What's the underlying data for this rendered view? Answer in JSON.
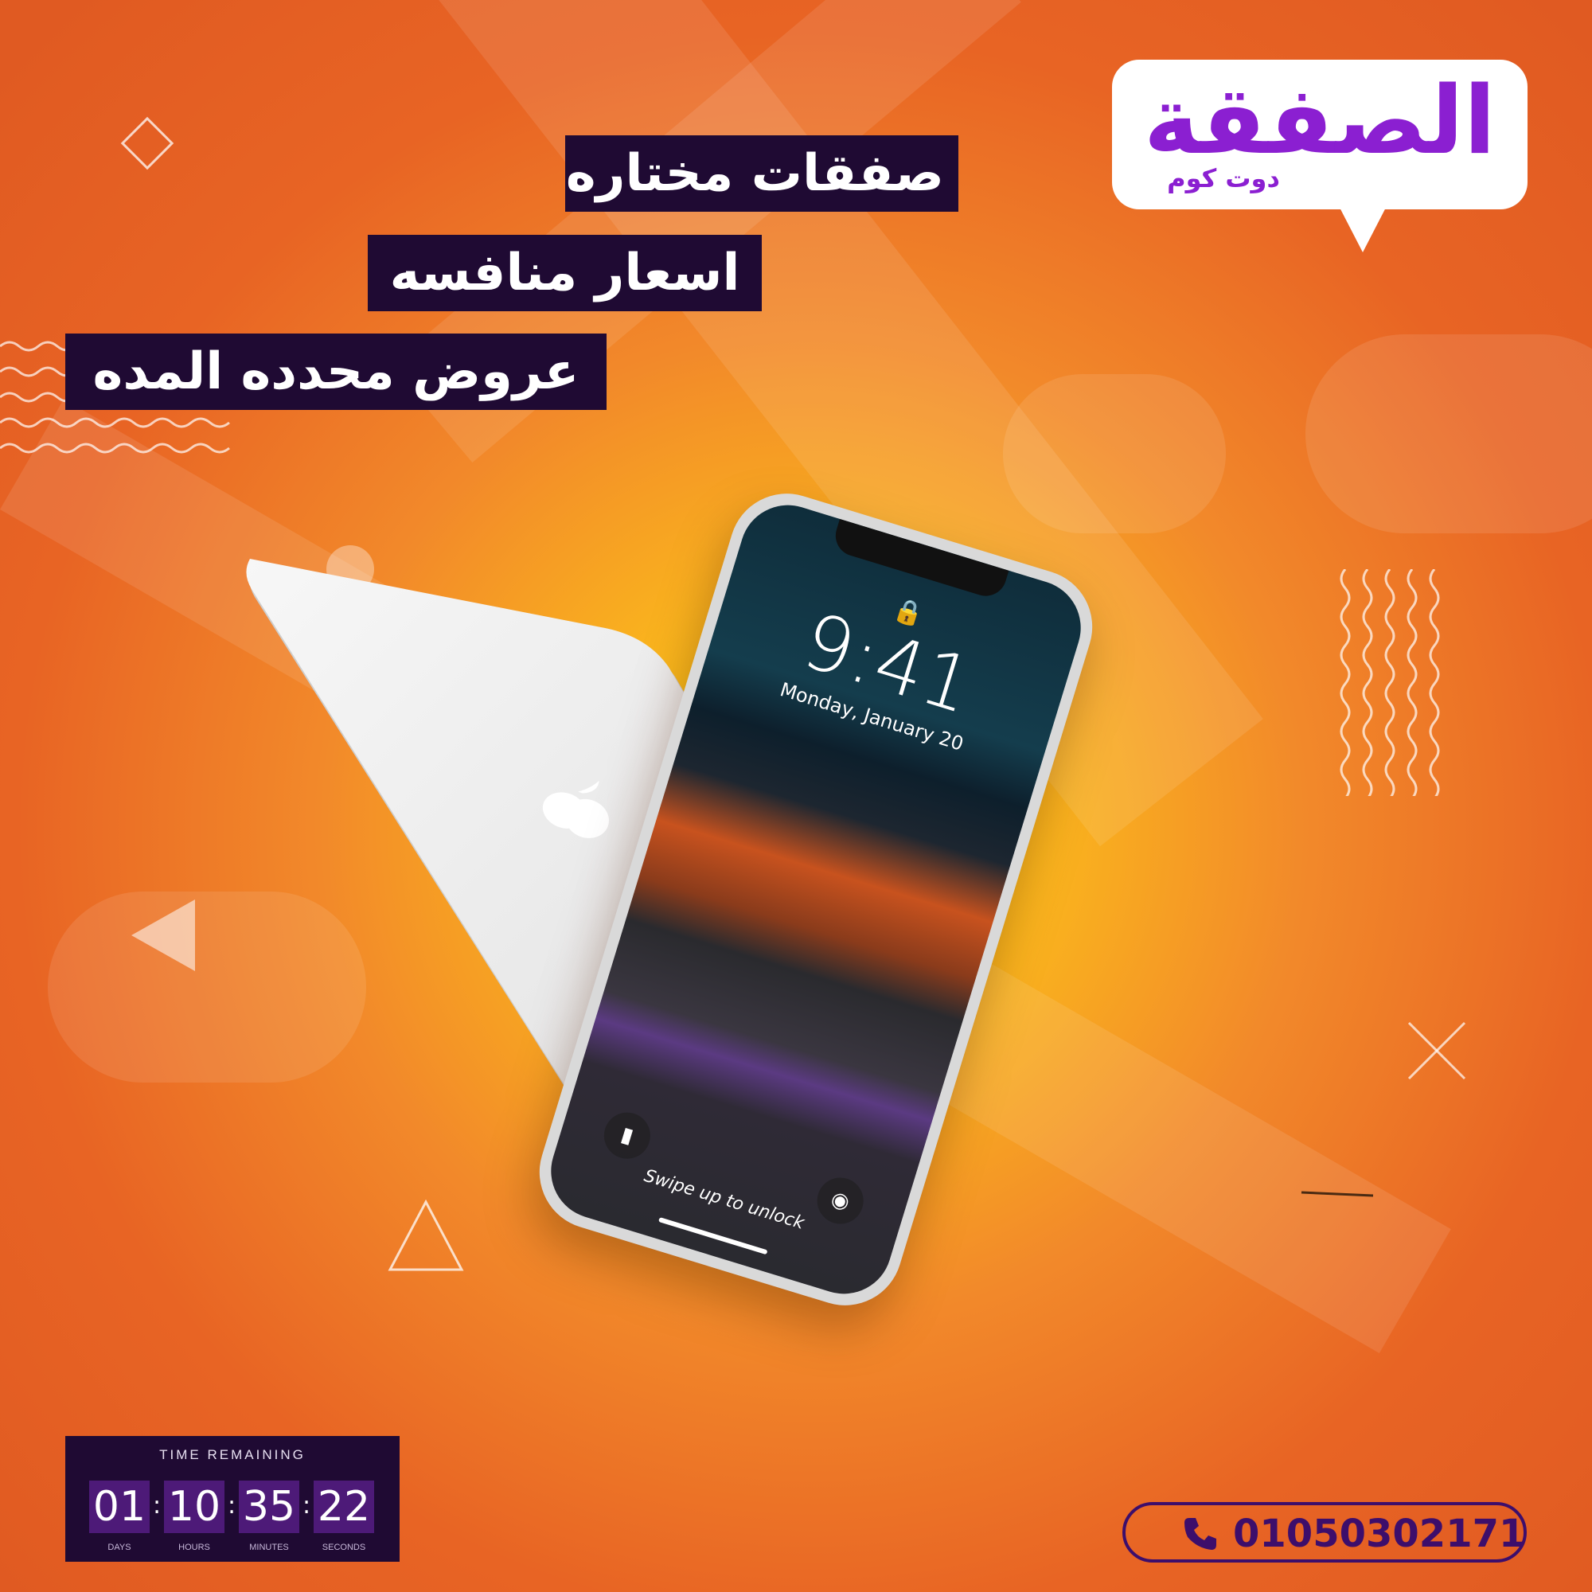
{
  "brand": {
    "logo_text": "الصفقة",
    "logo_subtext": "دوت كوم",
    "logo_color": "#8b1fd1",
    "logo_accent_color": "#ff8a1e"
  },
  "taglines": [
    "صفقات مختاره",
    "اسعار منافسه",
    "عروض محدده المده"
  ],
  "phone_screen": {
    "time": "9:41",
    "date": "Monday, January 20",
    "swipe_text": "Swipe up to unlock"
  },
  "timer": {
    "title": "TIME REMAINING",
    "units": [
      {
        "value": "01",
        "label": "DAYS"
      },
      {
        "value": "10",
        "label": "HOURS"
      },
      {
        "value": "35",
        "label": "MINUTES"
      },
      {
        "value": "22",
        "label": "SECONDS"
      }
    ]
  },
  "contact": {
    "phone": "01050302171",
    "icon": "phone-icon"
  },
  "colors": {
    "background": "#e8611f",
    "panel": "#1f0a33",
    "accent_purple": "#3d0e6b"
  }
}
